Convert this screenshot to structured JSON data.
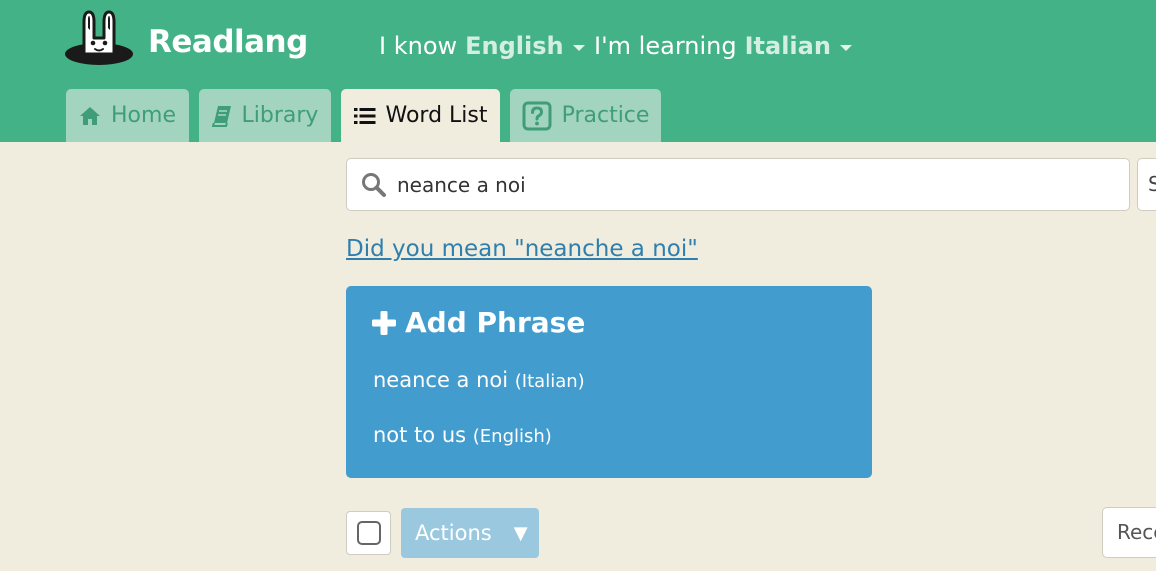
{
  "app": {
    "name": "Readlang"
  },
  "header": {
    "known": {
      "prefix": "I know",
      "language": "English"
    },
    "learning": {
      "prefix": "I'm learning",
      "language": "Italian"
    }
  },
  "tabs": [
    {
      "label": "Home",
      "icon": "home-icon",
      "active": false
    },
    {
      "label": "Library",
      "icon": "book-icon",
      "active": false
    },
    {
      "label": "Word List",
      "icon": "list-icon",
      "active": true
    },
    {
      "label": "Practice",
      "icon": "question-icon",
      "active": false
    }
  ],
  "search": {
    "value": "neance a noi",
    "placeholder": ""
  },
  "sort_select": {
    "value": "S"
  },
  "suggestion": {
    "text": "Did you mean \"neanche a noi\""
  },
  "add_phrase": {
    "title": "Add Phrase",
    "phrase": {
      "text": "neance a noi",
      "language": "(Italian)"
    },
    "translation": {
      "text": "not to us",
      "language": "(English)"
    }
  },
  "toolbar": {
    "actions_label": "Actions",
    "actions_caret": "▼",
    "order_select": "Rece"
  },
  "colors": {
    "header_green": "#44b287",
    "page_background": "#f0eddf",
    "add_panel_blue": "#439cce",
    "link_blue": "#2f7fae",
    "actions_button": "#9ac9df"
  }
}
